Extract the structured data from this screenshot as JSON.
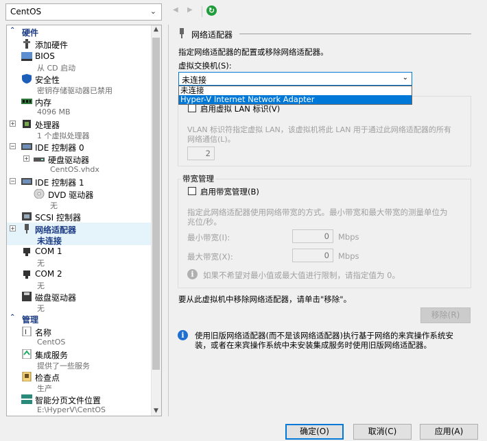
{
  "vm_select": {
    "value": "CentOS"
  },
  "tree": {
    "hardware_title": "硬件",
    "management_title": "管理",
    "items": [
      {
        "name": "添加硬件",
        "sub": ""
      },
      {
        "name": "BIOS",
        "sub": "从 CD 启动"
      },
      {
        "name": "安全性",
        "sub": "密钥存储驱动器已禁用"
      },
      {
        "name": "内存",
        "sub": "4096 MB"
      },
      {
        "name": "处理器",
        "sub": "1 个虚拟处理器"
      },
      {
        "name": "IDE 控制器 0",
        "sub": ""
      },
      {
        "name": "硬盘驱动器",
        "sub": "CentOS.vhdx"
      },
      {
        "name": "IDE 控制器 1",
        "sub": ""
      },
      {
        "name": "DVD 驱动器",
        "sub": "无"
      },
      {
        "name": "SCSI 控制器",
        "sub": ""
      },
      {
        "name": "网络适配器",
        "sub": "未连接"
      },
      {
        "name": "COM 1",
        "sub": "无"
      },
      {
        "name": "COM 2",
        "sub": "无"
      },
      {
        "name": "磁盘驱动器",
        "sub": "无"
      }
    ],
    "mgmt_items": [
      {
        "name": "名称",
        "sub": "CentOS"
      },
      {
        "name": "集成服务",
        "sub": "提供了一些服务"
      },
      {
        "name": "检查点",
        "sub": "生产"
      },
      {
        "name": "智能分页文件位置",
        "sub": "E:\\HyperV\\CentOS"
      }
    ]
  },
  "panel": {
    "section_title": "网络适配器",
    "description": "指定网络适配器的配置或移除网络适配器。",
    "switch_label": "虚拟交换机(S):",
    "switch_value": "未连接",
    "dropdown_options": [
      "未连接",
      "Hyper-V Internet Network Adapter"
    ],
    "vlan_checkbox": "启用虚拟 LAN 标识(V)",
    "vlan_desc_1": "VLAN 标识符指定虚拟 LAN，该虚拟机将此 LAN 用于通过此网络适配器的所有",
    "vlan_desc_2": "网络通信(L)。",
    "vlan_id": "2",
    "bw_title": "带宽管理",
    "bw_checkbox": "启用带宽管理(B)",
    "bw_desc_1": "指定此网络适配器使用网络带宽的方式。最小带宽和最大带宽的测量单位为",
    "bw_desc_2": "兆位/秒。",
    "min_label": "最小带宽(I):",
    "min_value": "0",
    "max_label": "最大带宽(X):",
    "max_value": "0",
    "unit": "Mbps",
    "limit_info": "如果不希望对最小值或最大值进行限制，请指定值为 0。",
    "remove_text": "要从此虚拟机中移除网络适配器，请单击\"移除\"。",
    "remove_button": "移除(R)",
    "legacy_info_1": "使用旧版网络适配器(而不是该网络适配器)执行基于网络的来宾操作系统安",
    "legacy_info_2": "装，或者在来宾操作系统中未安装集成服务时使用旧版网络适配器。"
  },
  "buttons": {
    "ok": "确定(O)",
    "cancel": "取消(C)",
    "apply": "应用(A)"
  },
  "colors": {
    "accent": "#0078d7",
    "category": "#1c3c84",
    "selected_bg": "#e5f3fb"
  }
}
